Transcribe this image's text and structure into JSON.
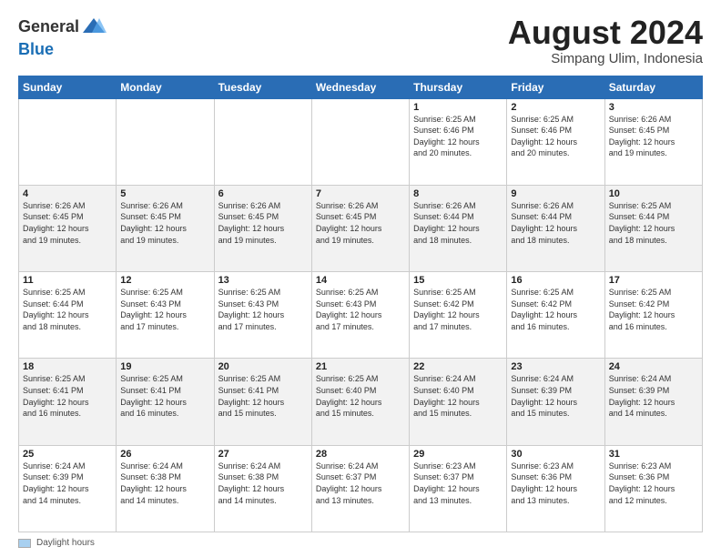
{
  "header": {
    "logo_line1": "General",
    "logo_line2": "Blue",
    "month_title": "August 2024",
    "subtitle": "Simpang Ulim, Indonesia"
  },
  "footer": {
    "daylight_label": "Daylight hours"
  },
  "weekdays": [
    "Sunday",
    "Monday",
    "Tuesday",
    "Wednesday",
    "Thursday",
    "Friday",
    "Saturday"
  ],
  "weeks": [
    [
      {
        "day": "",
        "info": ""
      },
      {
        "day": "",
        "info": ""
      },
      {
        "day": "",
        "info": ""
      },
      {
        "day": "",
        "info": ""
      },
      {
        "day": "1",
        "info": "Sunrise: 6:25 AM\nSunset: 6:46 PM\nDaylight: 12 hours\nand 20 minutes."
      },
      {
        "day": "2",
        "info": "Sunrise: 6:25 AM\nSunset: 6:46 PM\nDaylight: 12 hours\nand 20 minutes."
      },
      {
        "day": "3",
        "info": "Sunrise: 6:26 AM\nSunset: 6:45 PM\nDaylight: 12 hours\nand 19 minutes."
      }
    ],
    [
      {
        "day": "4",
        "info": "Sunrise: 6:26 AM\nSunset: 6:45 PM\nDaylight: 12 hours\nand 19 minutes."
      },
      {
        "day": "5",
        "info": "Sunrise: 6:26 AM\nSunset: 6:45 PM\nDaylight: 12 hours\nand 19 minutes."
      },
      {
        "day": "6",
        "info": "Sunrise: 6:26 AM\nSunset: 6:45 PM\nDaylight: 12 hours\nand 19 minutes."
      },
      {
        "day": "7",
        "info": "Sunrise: 6:26 AM\nSunset: 6:45 PM\nDaylight: 12 hours\nand 19 minutes."
      },
      {
        "day": "8",
        "info": "Sunrise: 6:26 AM\nSunset: 6:44 PM\nDaylight: 12 hours\nand 18 minutes."
      },
      {
        "day": "9",
        "info": "Sunrise: 6:26 AM\nSunset: 6:44 PM\nDaylight: 12 hours\nand 18 minutes."
      },
      {
        "day": "10",
        "info": "Sunrise: 6:25 AM\nSunset: 6:44 PM\nDaylight: 12 hours\nand 18 minutes."
      }
    ],
    [
      {
        "day": "11",
        "info": "Sunrise: 6:25 AM\nSunset: 6:44 PM\nDaylight: 12 hours\nand 18 minutes."
      },
      {
        "day": "12",
        "info": "Sunrise: 6:25 AM\nSunset: 6:43 PM\nDaylight: 12 hours\nand 17 minutes."
      },
      {
        "day": "13",
        "info": "Sunrise: 6:25 AM\nSunset: 6:43 PM\nDaylight: 12 hours\nand 17 minutes."
      },
      {
        "day": "14",
        "info": "Sunrise: 6:25 AM\nSunset: 6:43 PM\nDaylight: 12 hours\nand 17 minutes."
      },
      {
        "day": "15",
        "info": "Sunrise: 6:25 AM\nSunset: 6:42 PM\nDaylight: 12 hours\nand 17 minutes."
      },
      {
        "day": "16",
        "info": "Sunrise: 6:25 AM\nSunset: 6:42 PM\nDaylight: 12 hours\nand 16 minutes."
      },
      {
        "day": "17",
        "info": "Sunrise: 6:25 AM\nSunset: 6:42 PM\nDaylight: 12 hours\nand 16 minutes."
      }
    ],
    [
      {
        "day": "18",
        "info": "Sunrise: 6:25 AM\nSunset: 6:41 PM\nDaylight: 12 hours\nand 16 minutes."
      },
      {
        "day": "19",
        "info": "Sunrise: 6:25 AM\nSunset: 6:41 PM\nDaylight: 12 hours\nand 16 minutes."
      },
      {
        "day": "20",
        "info": "Sunrise: 6:25 AM\nSunset: 6:41 PM\nDaylight: 12 hours\nand 15 minutes."
      },
      {
        "day": "21",
        "info": "Sunrise: 6:25 AM\nSunset: 6:40 PM\nDaylight: 12 hours\nand 15 minutes."
      },
      {
        "day": "22",
        "info": "Sunrise: 6:24 AM\nSunset: 6:40 PM\nDaylight: 12 hours\nand 15 minutes."
      },
      {
        "day": "23",
        "info": "Sunrise: 6:24 AM\nSunset: 6:39 PM\nDaylight: 12 hours\nand 15 minutes."
      },
      {
        "day": "24",
        "info": "Sunrise: 6:24 AM\nSunset: 6:39 PM\nDaylight: 12 hours\nand 14 minutes."
      }
    ],
    [
      {
        "day": "25",
        "info": "Sunrise: 6:24 AM\nSunset: 6:39 PM\nDaylight: 12 hours\nand 14 minutes."
      },
      {
        "day": "26",
        "info": "Sunrise: 6:24 AM\nSunset: 6:38 PM\nDaylight: 12 hours\nand 14 minutes."
      },
      {
        "day": "27",
        "info": "Sunrise: 6:24 AM\nSunset: 6:38 PM\nDaylight: 12 hours\nand 14 minutes."
      },
      {
        "day": "28",
        "info": "Sunrise: 6:24 AM\nSunset: 6:37 PM\nDaylight: 12 hours\nand 13 minutes."
      },
      {
        "day": "29",
        "info": "Sunrise: 6:23 AM\nSunset: 6:37 PM\nDaylight: 12 hours\nand 13 minutes."
      },
      {
        "day": "30",
        "info": "Sunrise: 6:23 AM\nSunset: 6:36 PM\nDaylight: 12 hours\nand 13 minutes."
      },
      {
        "day": "31",
        "info": "Sunrise: 6:23 AM\nSunset: 6:36 PM\nDaylight: 12 hours\nand 12 minutes."
      }
    ]
  ]
}
